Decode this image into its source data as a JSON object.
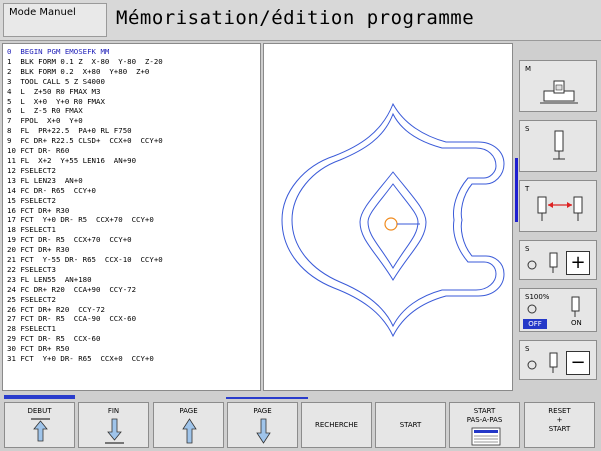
{
  "header": {
    "mode_label": "Mode Manuel",
    "title": "Mémorisation/édition programme"
  },
  "program": {
    "lines": [
      "0  BEGIN PGM EMOSEFK MM",
      "1  BLK FORM 0.1 Z  X-80  Y-80  Z-20",
      "2  BLK FORM 0.2  X+80  Y+80  Z+0",
      "3  TOOL CALL 5 Z S4000",
      "4  L  Z+50 R0 FMAX M3",
      "5  L  X+0  Y+0 R0 FMAX",
      "6  L  Z-5 R0 FMAX",
      "7  FPOL  X+0  Y+0",
      "8  FL  PR+22.5  PA+0 RL F750",
      "9  FC DR+ R22.5 CLSD+  CCX+0  CCY+0",
      "10 FCT DR- R60",
      "11 FL  X+2  Y+55 LEN16  AN+90",
      "12 FSELECT2",
      "13 FL LEN23  AN+0",
      "14 FC DR- R65  CCY+0",
      "15 FSELECT2",
      "16 FCT DR+ R30",
      "17 FCT  Y+0 DR- R5  CCX+70  CCY+0",
      "18 FSELECT1",
      "19 FCT DR- R5  CCX+70  CCY+0",
      "20 FCT DR+ R30",
      "21 FCT  Y-55 DR- R65  CCX-10  CCY+0",
      "22 FSELECT3",
      "23 FL LEN55  AN+180",
      "24 FC DR+ R20  CCA+90  CCY-72",
      "25 FSELECT2",
      "26 FCT DR+ R20  CCY-72",
      "27 FCT DR- R5  CCA-90  CCX-60",
      "28 FSELECT1",
      "29 FCT DR- R5  CCX-60",
      "30 FCT DR+ R50",
      "31 FCT  Y+0 DR- R65  CCX+0  CCY+0"
    ]
  },
  "side_softkeys": {
    "m_label": "M",
    "s_label": "S",
    "t_label": "T",
    "s_plus_label": "S",
    "plus": "+",
    "s100_label": "S100%",
    "off": "OFF",
    "on": "ON",
    "s_minus_label": "S",
    "minus": "−"
  },
  "bottom_softkeys": {
    "debut": "DEBUT",
    "fin": "FIN",
    "page_up": "PAGE",
    "page_down": "PAGE",
    "recherche": "RECHERCHE",
    "start": "START",
    "start_pas_1": "START",
    "start_pas_2": "PAS-A-PAS",
    "reset_1": "RESET",
    "reset_2": "+",
    "reset_3": "START"
  },
  "colors": {
    "accent": "#2438c8",
    "contour": "#3a5ad8",
    "tool": "#f08a1c"
  }
}
